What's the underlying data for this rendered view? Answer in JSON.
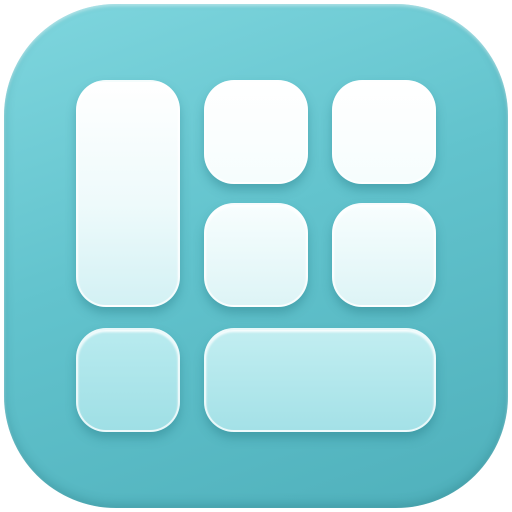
{
  "icon": {
    "name": "widget-grid-app-icon",
    "background_color": "#62c3cd",
    "tile_color": "#ffffff"
  }
}
